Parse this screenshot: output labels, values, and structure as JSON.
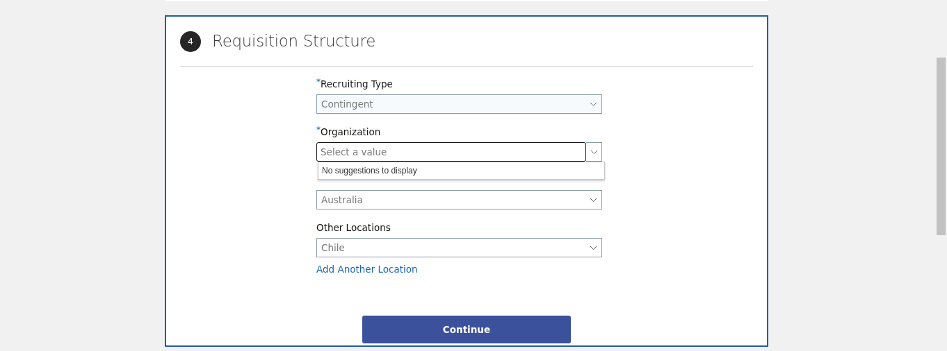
{
  "section": {
    "step": "4",
    "title": "Requisition Structure"
  },
  "fields": [
    {
      "kind": "select",
      "label": "Recruiting Type",
      "required_mark": "*",
      "value": "Contingent"
    },
    {
      "kind": "combobox",
      "label": "Organization",
      "required_mark": "*",
      "placeholder": "Select a value",
      "focused": true,
      "suggestions_message": "No suggestions to display"
    },
    {
      "kind": "select",
      "value": "Australia"
    },
    {
      "kind": "select",
      "label": "Other Locations",
      "value": "Chile"
    }
  ],
  "add_link": "Add Another Location",
  "continue_button": "Continue"
}
